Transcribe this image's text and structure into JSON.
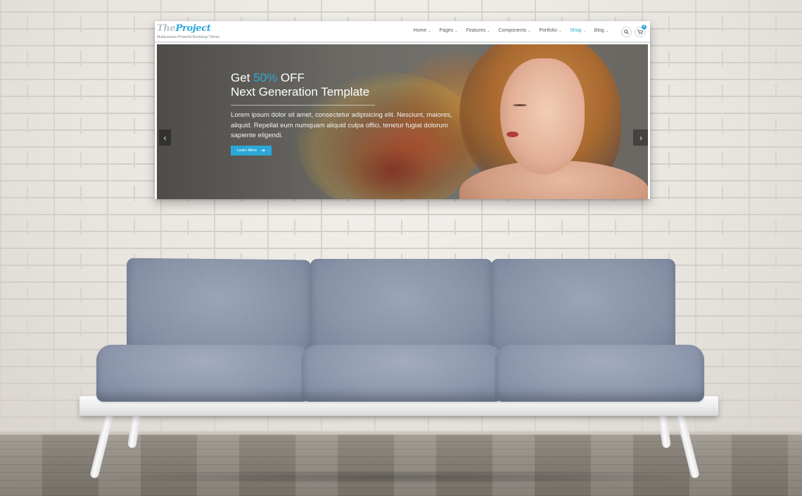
{
  "site": {
    "logo": {
      "prefix": "The",
      "name": "Project"
    },
    "tagline": "Multipurpose Powerful Bootstrap Theme",
    "nav": [
      {
        "label": "Home",
        "active": false
      },
      {
        "label": "Pages",
        "active": false
      },
      {
        "label": "Features",
        "active": false
      },
      {
        "label": "Components",
        "active": false
      },
      {
        "label": "Portfolio",
        "active": false
      },
      {
        "label": "Shop",
        "active": true
      },
      {
        "label": "Blog",
        "active": false
      }
    ],
    "header_buttons": {
      "search_icon": "search-icon",
      "cart_icon": "cart-icon",
      "cart_count": "0"
    }
  },
  "hero": {
    "title_prefix": "Get",
    "title_accent": "50%",
    "title_suffix": "OFF",
    "subtitle": "Next Generation Template",
    "body": "Lorem ipsum dolor sit amet, consectetur adipisicing elit. Nesciunt, maiores, aliquid. Repellat eum numquam aliquid culpa offici, tenetur fugiat dolorum sapiente eligendi.",
    "button_label": "Learn More",
    "prev_arrow": "‹",
    "next_arrow": "›"
  },
  "colors": {
    "accent": "#2ba8d8",
    "wall": "#ece9e3",
    "sofa_fabric": "#8f9ab0",
    "sofa_frame": "#f2f2f2"
  }
}
